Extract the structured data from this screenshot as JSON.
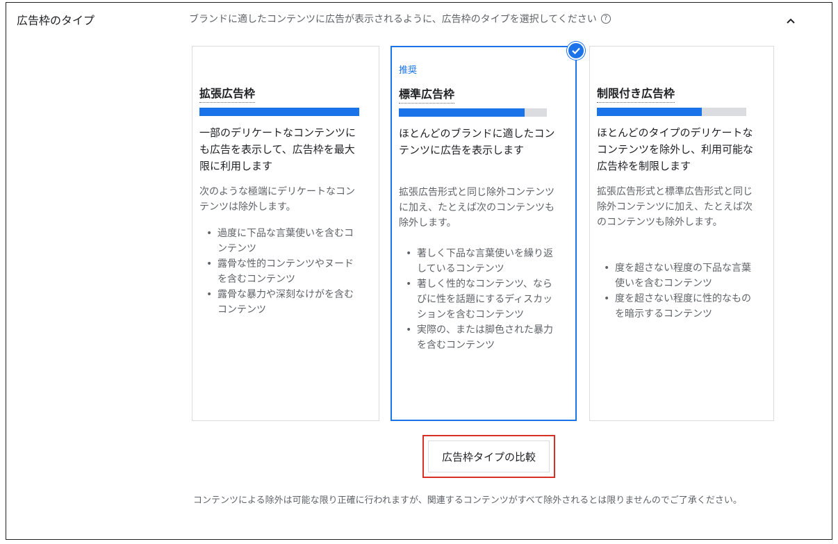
{
  "section": {
    "label": "広告枠のタイプ",
    "description": "ブランドに適したコンテンツに広告が表示されるように、広告枠のタイプを選択してください"
  },
  "colors": {
    "accent": "#1a73e8",
    "highlight": "#d93025",
    "track": "#dadce0"
  },
  "icons": {
    "help": "help-circle-icon",
    "collapse": "chevron-up-icon",
    "selected": "check-circle-icon"
  },
  "cards": [
    {
      "title": "拡張広告枠",
      "fill_percent": 100,
      "main": "一部のデリケートなコンテンツにも広告を表示して、広告枠を最大限に利用します",
      "sub": "次のような極端にデリケートなコンテンツは除外します。",
      "bullets": [
        "過度に下品な言葉使いを含むコンテンツ",
        "露骨な性的コンテンツやヌードを含むコンテンツ",
        "露骨な暴力や深刻なけがを含むコンテンツ"
      ]
    },
    {
      "badge": "推奨",
      "title": "標準広告枠",
      "selected": true,
      "fill_percent": 85,
      "main": "ほとんどのブランドに適したコンテンツに広告を表示します",
      "sub": "拡張広告形式と同じ除外コンテンツに加え、たとえば次のコンテンツも除外します。",
      "bullets": [
        "著しく下品な言葉使いを繰り返しているコンテンツ",
        "著しく性的なコンテンツ、ならびに性を話題にするディスカッションを含むコンテンツ",
        "実際の、または脚色された暴力を含むコンテンツ"
      ]
    },
    {
      "title": "制限付き広告枠",
      "fill_percent": 70,
      "main": "ほとんどのタイプのデリケートなコンテンツを除外し、利用可能な広告枠を制限します",
      "sub": "拡張広告形式と標準広告形式と同じ除外コンテンツに加え、たとえば次のコンテンツも除外します。",
      "bullets": [
        "度を超さない程度の下品な言葉使いを含むコンテンツ",
        "度を超さない程度に性的なものを暗示するコンテンツ"
      ]
    }
  ],
  "compare_button": "広告枠タイプの比較",
  "footnote": "コンテンツによる除外は可能な限り正確に行われますが、関連するコンテンツがすべて除外されるとは限りませんのでご了承ください。"
}
